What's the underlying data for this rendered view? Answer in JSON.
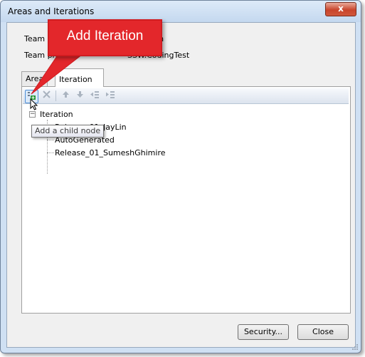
{
  "window": {
    "title": "Areas and Iterations",
    "close_glyph": "x"
  },
  "info": {
    "team_foundation_label": "Team Fo",
    "team_foundation_value": "icorn",
    "team_project_label": "Team project:",
    "team_project_value": "SSW.CodingTest"
  },
  "tabs": [
    {
      "label": "Area"
    },
    {
      "label": "Iteration"
    }
  ],
  "toolbar": {
    "add_child_icon": "add-child-node-icon",
    "delete_icon": "delete-icon",
    "move_up_icon": "arrow-up-icon",
    "move_down_icon": "arrow-down-icon",
    "outdent_icon": "outdent-icon",
    "indent_icon": "indent-icon"
  },
  "tree": {
    "root": "Iteration",
    "children": [
      "Release_01_JayLin",
      "AutoGenerated",
      "Release_01_SumeshGhimire"
    ]
  },
  "tooltip": "Add a child node",
  "callout": {
    "text": "Add Iteration",
    "color": "#e3272b"
  },
  "buttons": {
    "security": "Security...",
    "close": "Close"
  }
}
